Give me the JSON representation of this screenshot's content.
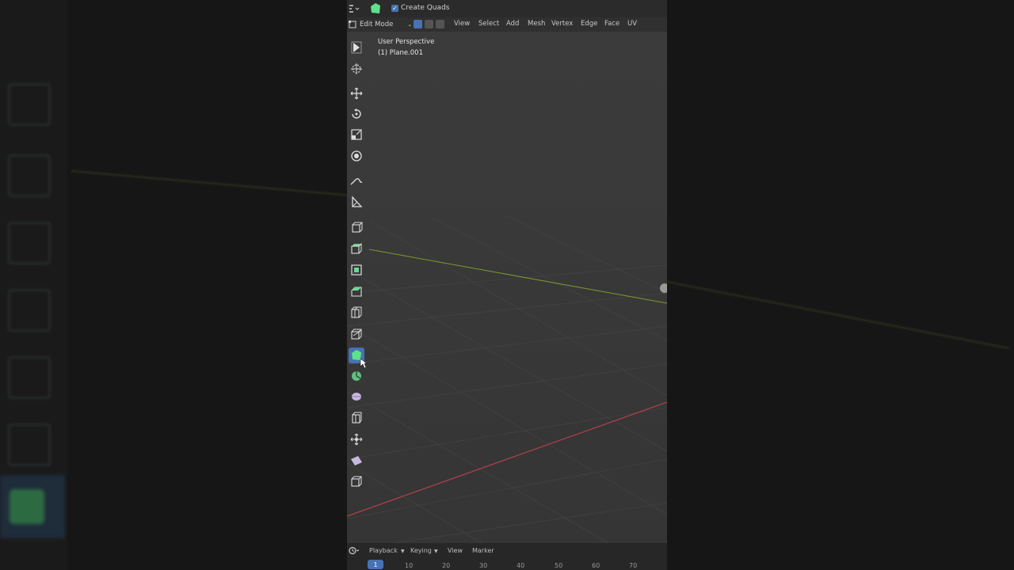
{
  "topbar": {
    "checkbox_label": "Create Quads",
    "checkbox_checked": true
  },
  "menubar": {
    "mode": "Edit Mode",
    "items": [
      "View",
      "Select",
      "Add",
      "Mesh",
      "Vertex",
      "Edge",
      "Face",
      "UV"
    ]
  },
  "viewport": {
    "perspective_label": "User Perspective",
    "object_label": "(1) Plane.001"
  },
  "toolbar": {
    "tools": [
      "select-box-icon",
      "cursor-icon",
      "move-icon",
      "rotate-icon",
      "scale-icon",
      "transform-icon",
      "annotate-icon",
      "measure-icon",
      "add-cube-icon",
      "extrude-region-icon",
      "inset-faces-icon",
      "bevel-icon",
      "loop-cut-icon",
      "knife-icon",
      "poly-build-icon",
      "spin-icon",
      "smooth-icon",
      "edge-slide-icon",
      "shrink-fatten-icon",
      "shear-icon",
      "rip-region-icon"
    ],
    "active_tool": "poly-build-icon"
  },
  "timeline": {
    "menu": [
      "Playback",
      "Keying",
      "View",
      "Marker"
    ],
    "current_frame": "1",
    "frame_ticks": [
      "10",
      "20",
      "30",
      "40",
      "50",
      "60",
      "70"
    ]
  },
  "colors": {
    "accent": "#4772b3",
    "active_tool_green": "#5fe08a",
    "x_axis": "#b5404a",
    "y_axis": "#7f9a2c"
  }
}
